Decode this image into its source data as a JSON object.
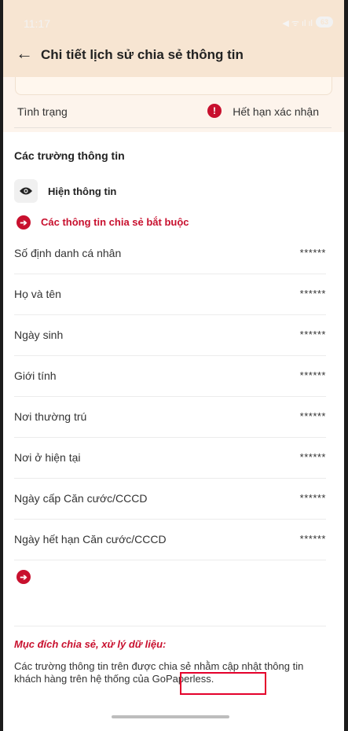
{
  "status_bar": {
    "time": "11:17",
    "battery": "63"
  },
  "header": {
    "title": "Chi tiết lịch sử chia sẻ thông tin"
  },
  "status": {
    "label": "Tình trạng",
    "value": "Hết hạn xác nhận"
  },
  "fields": {
    "section_title": "Các trường thông tin",
    "show_label": "Hiện thông tin",
    "required_label": "Các thông tin chia sẻ bắt buộc",
    "items": [
      {
        "label": "Số định danh cá nhân",
        "value": "******"
      },
      {
        "label": "Họ và tên",
        "value": "******"
      },
      {
        "label": "Ngày sinh",
        "value": "******"
      },
      {
        "label": "Giới tính",
        "value": "******"
      },
      {
        "label": "Nơi thường trú",
        "value": "******"
      },
      {
        "label": "Nơi ở hiện tại",
        "value": "******"
      },
      {
        "label": "Ngày cấp Căn cước/CCCD",
        "value": "******"
      },
      {
        "label": "Ngày hết hạn Căn cước/CCCD",
        "value": "******"
      }
    ]
  },
  "purpose": {
    "title": "Mục đích chia sẻ, xử lý dữ liệu:",
    "text": "Các trường thông tin trên được chia sẻ nhằm cập nhật thông tin khách hàng trên hệ thống của GoPaperless."
  },
  "colors": {
    "accent": "#c8102e",
    "header_bg": "#f7e5d2",
    "highlight_box": "#e4002b"
  }
}
